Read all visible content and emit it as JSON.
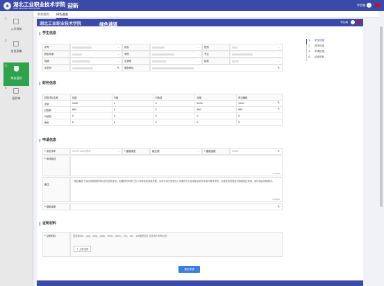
{
  "app": {
    "school_name": "湖北工业职业技术学院",
    "school_name_en": "HUBEI INDUSTRIAL POLYTECHNIC",
    "title": "迎新",
    "user_label": "学生端",
    "frame_title": "绿色通道"
  },
  "sidebar": {
    "steps": [
      {
        "num": "1",
        "label": "入学须知"
      },
      {
        "num": "2",
        "label": "信息采集"
      },
      {
        "num": "3",
        "label": "财务报到"
      },
      {
        "num": "4",
        "label": "报到单"
      }
    ]
  },
  "tabs": [
    {
      "label": "财务报到"
    },
    {
      "label": "绿色通道"
    }
  ],
  "sections": {
    "student": "学生信息",
    "finance": "财务信息",
    "apply": "申请信息",
    "proof": "证明材料"
  },
  "student": {
    "labels": [
      "学号",
      "姓名",
      "性别",
      "报名年度",
      "学院",
      "专业",
      "班级",
      "生源地",
      "民族",
      "手机号",
      "家庭地址"
    ],
    "values": [
      "",
      "",
      "",
      "",
      "",
      "",
      "",
      "",
      "",
      "",
      ""
    ]
  },
  "finance": {
    "headers": [
      "财务项目名称",
      "应缴",
      "已缴",
      "已免费",
      "未缴",
      "申请缓缴"
    ],
    "rows": [
      [
        "学费",
        "5000",
        "0",
        "0",
        "5000",
        "5000"
      ],
      [
        "住宿费",
        "680",
        "0",
        "0",
        "680",
        "680"
      ],
      [
        "代收费",
        "0",
        "0",
        "0",
        "0",
        "0"
      ],
      [
        "教材",
        "0",
        "0",
        "0",
        "0",
        "0"
      ]
    ]
  },
  "apply": {
    "year_label": "评定学年",
    "year_value": "2025-2026学年",
    "type_label": "缓缴类型",
    "type_value": "缓交费",
    "amount_label": "缓缴金额",
    "amount_value": "5680",
    "desc_label": "申请描述",
    "counter1": "0/1000",
    "remark_label": "备注",
    "remark_text": "\"绿色通道\"已将资助缓缴的申请状况告知家长，如果您的同学已在人学报到前就读资格，请家长将已领到的入学通知书以及录取证明文件原件带来学校，请按学校流程及时缴纳相应费用，我们将会协助解决。",
    "counter2": "0/1000",
    "pay_label": "缴款金额"
  },
  "proof": {
    "label": "证明材料",
    "hint": "仅支持doc，.jpg，.png，.jpeg，.bmp，.docx，.zip，.rar，.pdf类型文件 文件大小5MB以内",
    "upload_label": "上传文件"
  },
  "right_nav": [
    {
      "num": "1.",
      "label": "学生信息"
    },
    {
      "num": "2.",
      "label": "财务信息"
    },
    {
      "num": "3.",
      "label": "申请信息"
    },
    {
      "num": "4.",
      "label": "证明材料"
    }
  ],
  "submit_label": "提交申请",
  "colors": {
    "primary": "#3b4aa8",
    "active_step": "#2fa24c",
    "button": "#3b7de0"
  }
}
